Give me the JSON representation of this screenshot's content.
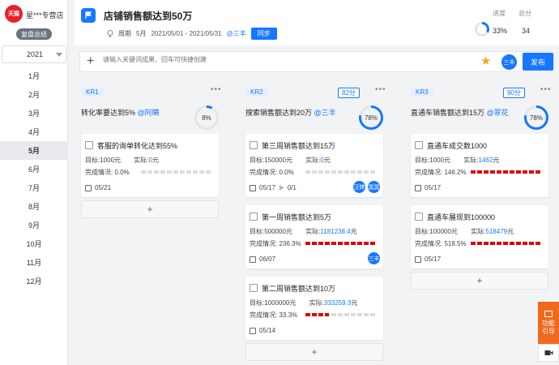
{
  "shop": {
    "logo_text": "天猫",
    "name": "星***专营店",
    "review_btn": "复盘总结"
  },
  "year_select": {
    "value": "2021"
  },
  "months": [
    "1月",
    "2月",
    "3月",
    "4月",
    "5月",
    "6月",
    "7月",
    "8月",
    "9月",
    "10月",
    "11月",
    "12月"
  ],
  "active_month_index": 4,
  "objective": {
    "title": "店铺销售额达到50万",
    "period_label": "周期",
    "month": "5月",
    "date_range": "2021/05/01 - 2021/05/31",
    "owner": "@三丰",
    "sync_label": "同步",
    "progress_label": "进度",
    "score_label": "总分",
    "progress_value": "33%",
    "progress_fraction": 0.33,
    "score_value": "34"
  },
  "input_bar": {
    "placeholder": "请输入关键词成果、回车可快捷创建",
    "avatar_text": "三丰",
    "publish_label": "发布"
  },
  "colors": {
    "accent": "#1677ff",
    "danger": "#e00000",
    "guide": "#f06a1e"
  },
  "krs": [
    {
      "tag": "KR1",
      "score": "",
      "more": "•••",
      "title": "转化率要达到5%",
      "owner": "@阿瞒",
      "progress": "8%",
      "progress_fraction": 0.08,
      "tasks": [
        {
          "title": "客服的询单转化达到55%",
          "target_label": "目标:",
          "target": "1000元",
          "actual_label": "实际:",
          "actual": "0",
          "actual_unit": "元",
          "completion_label": "完成情况:",
          "completion": "0.0%",
          "completion_fraction": 0.0,
          "date": "05/21",
          "subtasks": "",
          "assignees": []
        }
      ]
    },
    {
      "tag": "KR2",
      "score": "82分",
      "more": "•••",
      "title": "搜索销售额达到20万",
      "owner": "@三丰",
      "progress": "78%",
      "progress_fraction": 0.78,
      "tasks": [
        {
          "title": "第三周销售额达到15万",
          "target_label": "目标:",
          "target": "150000元",
          "actual_label": "实际:",
          "actual": "0",
          "actual_unit": "元",
          "completion_label": "完成情况:",
          "completion": "0.0%",
          "completion_fraction": 0.0,
          "date": "05/17",
          "subtasks": "0/1",
          "assignees": [
            "汪婷",
            "晁晁"
          ]
        },
        {
          "title": "第一周销售额达到5万",
          "target_label": "目标:",
          "target": "500000元",
          "actual_label": "实际:",
          "actual": "1181238.4",
          "actual_unit": "元",
          "completion_label": "完成情况:",
          "completion": "236.3%",
          "completion_fraction": 1.0,
          "date": "06/07",
          "subtasks": "",
          "assignees": [
            "三丰"
          ]
        },
        {
          "title": "第二周销售额达到10万",
          "target_label": "目标:",
          "target": "1000000元",
          "actual_label": "实际:",
          "actual": "333259.3",
          "actual_unit": "元",
          "completion_label": "完成情况:",
          "completion": "33.3%",
          "completion_fraction": 0.333,
          "date": "05/14",
          "subtasks": "",
          "assignees": []
        }
      ]
    },
    {
      "tag": "KR3",
      "score": "90分",
      "more": "•••",
      "title": "直通车销售额达到15万",
      "owner": "@翠花",
      "progress": "78%",
      "progress_fraction": 0.78,
      "tasks": [
        {
          "title": "直通车成交数1000",
          "target_label": "目标:",
          "target": "1000元",
          "actual_label": "实际:",
          "actual": "1462",
          "actual_unit": "元",
          "completion_label": "完成情况:",
          "completion": "146.2%",
          "completion_fraction": 1.0,
          "date": "05/17",
          "subtasks": "",
          "assignees": []
        },
        {
          "title": "直通车展现到100000",
          "target_label": "目标:",
          "target": "100000元",
          "actual_label": "实际:",
          "actual": "518479",
          "actual_unit": "元",
          "completion_label": "完成情况:",
          "completion": "518.5%",
          "completion_fraction": 1.0,
          "date": "05/17",
          "subtasks": "",
          "assignees": []
        }
      ]
    }
  ],
  "add_label": "+",
  "guide_button": {
    "line1": "功能",
    "line2": "引导"
  }
}
